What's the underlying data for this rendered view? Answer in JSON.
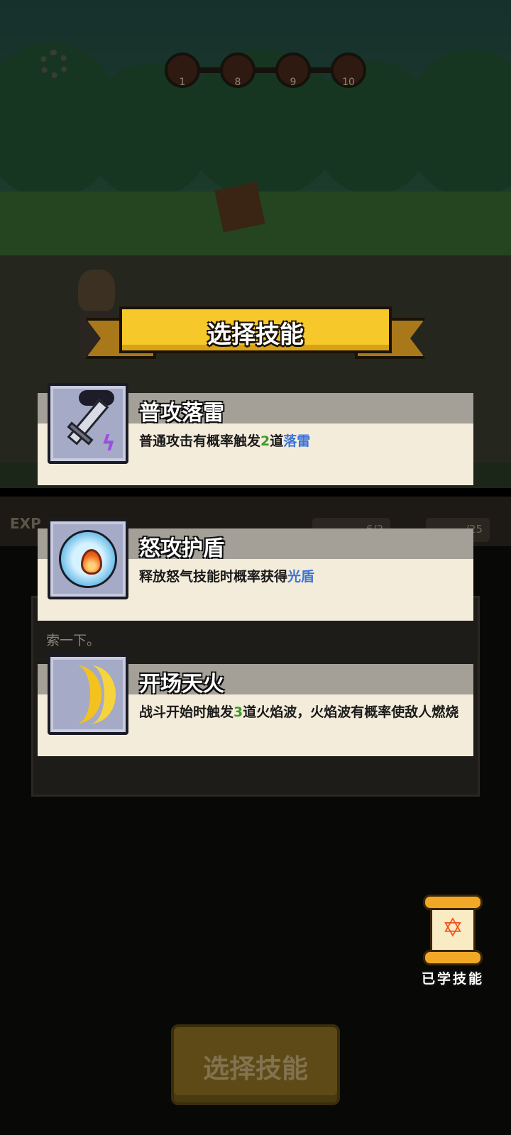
{
  "stages": [
    "1",
    "8",
    "9",
    "10"
  ],
  "ui": {
    "exp_label": "EXP",
    "stat_values": [
      "6/2",
      "/25"
    ]
  },
  "log": {
    "text": "索一下。"
  },
  "dialog": {
    "title": "选择技能"
  },
  "skills": [
    {
      "name": "普攻落雷",
      "desc_parts": [
        "普通攻击有概率触发",
        "2",
        "道",
        "落雷",
        ""
      ],
      "icon": "sword-lightning-icon"
    },
    {
      "name": "怒攻护盾",
      "desc_parts": [
        "释放怒气技能时概率获得",
        "光盾"
      ],
      "icon": "flame-orb-icon"
    },
    {
      "name": "开场天火",
      "desc_parts": [
        "战斗开始时触发",
        "3",
        "道火焰波，火焰波有概率使敌人燃烧"
      ],
      "icon": "double-crescent-icon"
    }
  ],
  "learned_skills": {
    "label": "已学技能",
    "icon": "star-of-david-icon"
  },
  "confirm_button": {
    "label": "选择技能"
  },
  "colors": {
    "highlight_number": "#3f9a2a",
    "highlight_keyword": "#3d74d8",
    "banner": "#f6c82a"
  }
}
